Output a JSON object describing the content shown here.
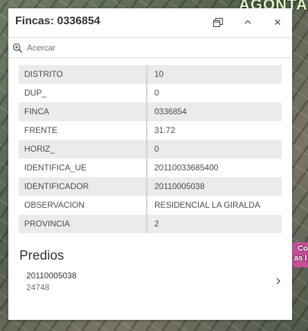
{
  "map": {
    "label_top": "AGONTA",
    "label_side1": "Co",
    "label_side2": "as I"
  },
  "popup": {
    "title": "Fincas: 0336854",
    "zoom_label": "Acercar",
    "attributes": [
      {
        "key": "DISTRITO",
        "value": "10"
      },
      {
        "key": "DUP_",
        "value": "0"
      },
      {
        "key": "FINCA",
        "value": "0336854"
      },
      {
        "key": "FRENTE",
        "value": "31.72"
      },
      {
        "key": "HORIZ_",
        "value": "0"
      },
      {
        "key": "IDENTIFICA_UE",
        "value": "20110033685400"
      },
      {
        "key": "IDENTIFICADOR",
        "value": "20110005038"
      },
      {
        "key": "OBSERVACION",
        "value": "RESIDENCIAL LA GIRALDA"
      },
      {
        "key": "PROVINCIA",
        "value": "2"
      }
    ],
    "related_title": "Predios",
    "related_items": [
      {
        "primary": "20110005038",
        "secondary": "24748"
      }
    ]
  },
  "icons": {
    "dock": "dock-icon",
    "collapse": "chevron-up-icon",
    "close": "close-icon",
    "zoom": "zoom-in-icon",
    "chevron": "chevron-right-icon"
  },
  "colors": {
    "panel_bg": "#ffffff",
    "row_alt": "#ebebeb",
    "text": "#323232",
    "muted": "#6e6e6e"
  }
}
